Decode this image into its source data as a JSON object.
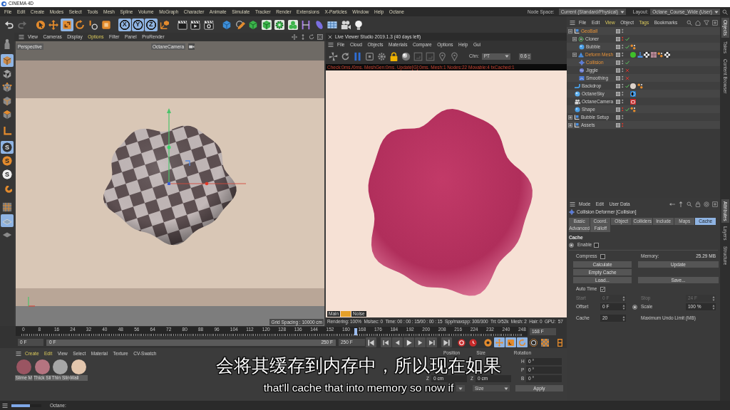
{
  "title_bar": {
    "title": "CINEMA 4D"
  },
  "menu_bar": {
    "items": [
      "File",
      "Edit",
      "Create",
      "Modes",
      "Select",
      "Tools",
      "Mesh",
      "Spline",
      "Volume",
      "MoGraph",
      "Character",
      "Animate",
      "Simulate",
      "Tracker",
      "Render",
      "Extensions",
      "X-Particles",
      "Window",
      "Help",
      "Octane"
    ],
    "node_space": {
      "label": "Node Space:",
      "value": "Current (Standard/Physical)"
    },
    "layout": {
      "label": "Layout:",
      "value": "Octane_Course_Wide (User)"
    }
  },
  "toolbar": [
    {
      "kind": "undo",
      "selected": false
    },
    {
      "kind": "redo",
      "selected": false
    },
    {
      "kind": "select",
      "selected": false
    },
    {
      "kind": "move",
      "selected": false
    },
    {
      "kind": "scale",
      "selected": true
    },
    {
      "kind": "rotate",
      "selected": false
    },
    {
      "kind": "recent",
      "selected": false
    },
    {
      "kind": "tile",
      "selected": false
    },
    {
      "kind": "axis",
      "label": "X",
      "selected": true
    },
    {
      "kind": "axis",
      "label": "Y",
      "selected": true
    },
    {
      "kind": "axis",
      "label": "Z",
      "selected": true
    },
    {
      "kind": "coords",
      "selected": false
    },
    {
      "kind": "renderview",
      "selected": false
    },
    {
      "kind": "render",
      "selected": false
    },
    {
      "kind": "rendersettings",
      "selected": false
    },
    {
      "kind": "cube",
      "selected": false
    },
    {
      "kind": "pen",
      "selected": false
    },
    {
      "kind": "subdivide",
      "selected": false
    },
    {
      "kind": "extrude",
      "selected": false
    },
    {
      "kind": "cloner",
      "selected": false
    },
    {
      "kind": "mograph",
      "selected": false
    },
    {
      "kind": "deformer",
      "selected": false
    },
    {
      "kind": "field",
      "selected": false
    },
    {
      "kind": "floor",
      "selected": false
    },
    {
      "kind": "camera",
      "selected": false
    },
    {
      "kind": "light",
      "selected": false
    }
  ],
  "tool_column": [
    {
      "kind": "figure",
      "selected": false
    },
    {
      "kind": "object",
      "selected": true
    },
    {
      "kind": "texture",
      "selected": false
    },
    {
      "kind": "points",
      "selected": false
    },
    {
      "kind": "edges",
      "selected": false
    },
    {
      "kind": "polygons",
      "selected": false
    },
    {
      "kind": "corner",
      "selected": false
    },
    {
      "kind": "snap",
      "label": "S",
      "selected": true
    },
    {
      "kind": "quantize",
      "label": "S",
      "selected": false
    },
    {
      "kind": "symmetry",
      "label": "S",
      "selected": false
    },
    {
      "kind": "magnet",
      "selected": false
    },
    {
      "kind": "plane",
      "selected": false
    },
    {
      "kind": "workplane",
      "selected": true
    },
    {
      "kind": "grid",
      "selected": false
    }
  ],
  "viewport": {
    "menu": [
      {
        "label": "View",
        "highlighted": false
      },
      {
        "label": "Cameras",
        "highlighted": false
      },
      {
        "label": "Display",
        "highlighted": false
      },
      {
        "label": "Options",
        "highlighted": true
      },
      {
        "label": "Filter",
        "highlighted": false
      },
      {
        "label": "Panel",
        "highlighted": false
      },
      {
        "label": "ProRender",
        "highlighted": false
      }
    ],
    "view_name": "Perspective",
    "camera": "OctaneCamera",
    "grid_spacing": "Grid Spacing : 10000 cm"
  },
  "live_viewer": {
    "title": "Live Viewer Studio 2019.1.3 (40 days left)",
    "menu": [
      "File",
      "Cloud",
      "Objects",
      "Materials",
      "Compare",
      "Options",
      "Help",
      "Gui"
    ],
    "channel": {
      "label": "Chn:",
      "value": "PT"
    },
    "exposure": "0.6",
    "log": "Check:0ms./0ms. MeshGen:0ms. Update[G]:0ms. Mesh:1 Nodes:22 Movable:4 txCached:1",
    "passes": [
      {
        "label": "Main",
        "selected": false
      },
      {
        "selected": true
      },
      {
        "label": "Noise",
        "selected": false
      }
    ],
    "stats": [
      "Rendering: 100%",
      "Ms/sec: 0",
      "Time: 00 : 00 : 15/00 : 00 : 15",
      "Spp/maxspp: 300/300",
      "Tri: 0/52k",
      "Mesh: 2",
      "Hair: 0",
      "GPU:",
      "57"
    ]
  },
  "objects": {
    "menu": [
      {
        "label": "File",
        "highlighted": false
      },
      {
        "label": "Edit",
        "highlighted": false
      },
      {
        "label": "View",
        "highlighted": true
      },
      {
        "label": "Object",
        "highlighted": false
      },
      {
        "label": "Tags",
        "highlighted": true
      },
      {
        "label": "Bookmarks",
        "highlighted": false
      }
    ],
    "items": [
      {
        "name": "GeoBall",
        "kind": "null",
        "selected": true,
        "hidden": false,
        "expanded": true,
        "children": [
          {
            "name": "Cloner",
            "kind": "cloner",
            "selected": false,
            "hidden": true,
            "enabled": true,
            "expanded": true,
            "children": [
              {
                "name": "Bubble",
                "kind": "sphere",
                "selected": false,
                "hidden": false,
                "enabled": true,
                "tags": [
                  {
                    "kind": "dots"
                  }
                ]
              }
            ]
          },
          {
            "name": "Deform Mesh",
            "kind": "deformer",
            "selected": true,
            "hidden": false,
            "expanded": true,
            "tags": [
              {
                "kind": "material",
                "color": "#3fbf2a"
              },
              {
                "kind": "pin"
              },
              {
                "kind": "checker"
              },
              {
                "kind": "texture"
              },
              {
                "kind": "dots"
              },
              {
                "kind": "checker"
              }
            ],
            "children": [
              {
                "name": "Collision",
                "kind": "collision",
                "selected": true,
                "hidden": false,
                "enabled": true
              },
              {
                "name": "Jiggle",
                "kind": "jiggle",
                "selected": false,
                "hidden": false,
                "enabled": false
              },
              {
                "name": "Smoothing",
                "kind": "smoothing",
                "selected": false,
                "hidden": false,
                "enabled": false
              }
            ]
          },
          {
            "name": "Backdrop",
            "kind": "backdrop",
            "selected": false,
            "hidden": false,
            "enabled": true,
            "tags": [
              {
                "kind": "material",
                "color": "#ddd2ca"
              },
              {
                "kind": "dots"
              }
            ]
          },
          {
            "name": "OctaneSky",
            "kind": "sky",
            "selected": false,
            "hidden": false,
            "tags": [
              {
                "kind": "sky"
              }
            ]
          },
          {
            "name": "OctaneCamera",
            "kind": "camera",
            "selected": false,
            "hidden": false,
            "tags": [
              {
                "kind": "camera"
              }
            ]
          },
          {
            "name": "Shape",
            "kind": "sphere",
            "selected": false,
            "hidden": true,
            "enabled": true,
            "tags": [
              {
                "kind": "dots"
              }
            ]
          }
        ]
      },
      {
        "name": "Bubble Setup",
        "kind": "null",
        "selected": false,
        "hidden": false,
        "expanded": false
      },
      {
        "name": "Assets",
        "kind": "null",
        "selected": false,
        "hidden": true,
        "expanded": false
      }
    ]
  },
  "attributes": {
    "menu": [
      "Mode",
      "Edit",
      "User Data"
    ],
    "title": "Collision Deformer [Collision]",
    "tabs": [
      {
        "label": "Basic",
        "selected": false
      },
      {
        "label": "Coord.",
        "selected": false
      },
      {
        "label": "Object",
        "selected": false
      },
      {
        "label": "Colliders",
        "selected": false
      },
      {
        "label": "Include",
        "selected": false
      },
      {
        "label": "Maps",
        "selected": false
      },
      {
        "label": "Cache",
        "selected": true
      },
      {
        "label": "Advanced",
        "selected": false
      },
      {
        "label": "Falloff",
        "selected": false
      }
    ],
    "section": "Cache",
    "enable": {
      "label": "Enable",
      "checked": false,
      "keyable": true
    },
    "compress": {
      "label": "Compress",
      "checked": false
    },
    "memory": {
      "label": "Memory:",
      "value": "25.29 MB"
    },
    "buttons": [
      "Calculate",
      "Update",
      "Empty Cache",
      "Load...",
      "Save..."
    ],
    "auto_time": {
      "label": "Auto Time",
      "checked": true
    },
    "fields": [
      {
        "label": "Start",
        "value": "0 F",
        "disabled": true,
        "keyable": false
      },
      {
        "label": "Stop",
        "value": "24 F",
        "disabled": true,
        "keyable": false
      },
      {
        "label": "Offset",
        "value": "0 F",
        "disabled": false,
        "keyable": false
      },
      {
        "label": "Scale",
        "value": "100 %",
        "disabled": false,
        "keyable": true
      },
      {
        "label": "Cache",
        "value": "20",
        "disabled": false,
        "keyable": false
      }
    ],
    "undo_limit": "Maximum Undo Limit (MB)"
  },
  "side_tabs": {
    "top": [
      {
        "label": "Objects",
        "selected": true
      },
      {
        "label": "Takes",
        "selected": false
      },
      {
        "label": "Content Browser",
        "selected": false
      }
    ],
    "bottom": [
      {
        "label": "Attributes",
        "selected": true
      },
      {
        "label": "Layers",
        "selected": false
      },
      {
        "label": "Structure",
        "selected": false
      }
    ]
  },
  "timeline": {
    "frames": [
      "0",
      "8",
      "16",
      "24",
      "32",
      "40",
      "48",
      "56",
      "64",
      "72",
      "80",
      "88",
      "96",
      "104",
      "112",
      "120",
      "128",
      "136",
      "144",
      "152",
      "160",
      "168",
      "176",
      "184",
      "192",
      "200",
      "208",
      "216",
      "224",
      "232",
      "240",
      "248"
    ],
    "playhead": {
      "level": 0.672
    },
    "current": "168 F"
  },
  "transport": {
    "start": "0 F",
    "range": {
      "start": "0 F",
      "end": "250 F",
      "level": 1
    },
    "end": "250 F",
    "buttons": [
      {
        "kind": "first",
        "selected": false
      },
      {
        "kind": "prevkey",
        "selected": false
      },
      {
        "kind": "prev",
        "selected": false
      },
      {
        "kind": "play",
        "selected": false
      },
      {
        "kind": "next",
        "selected": false
      },
      {
        "kind": "nextkey",
        "selected": false
      },
      {
        "kind": "last",
        "selected": false
      },
      {
        "kind": "record",
        "selected": false
      },
      {
        "kind": "autokey",
        "selected": false
      },
      {
        "kind": "keytarget",
        "selected": false
      },
      {
        "kind": "keymove",
        "selected": true
      },
      {
        "kind": "keyscale",
        "selected": true
      },
      {
        "kind": "keyrotate",
        "selected": true
      },
      {
        "kind": "keyparam",
        "selected": false
      },
      {
        "kind": "keypla",
        "selected": false
      },
      {
        "kind": "timeline",
        "selected": false
      }
    ]
  },
  "materials": {
    "menu": [
      {
        "label": "Create",
        "highlighted": true
      },
      {
        "label": "Edit",
        "highlighted": true
      },
      {
        "label": "View",
        "highlighted": false
      },
      {
        "label": "Select",
        "highlighted": false
      },
      {
        "label": "Material",
        "highlighted": false
      },
      {
        "label": "Texture",
        "highlighted": false
      },
      {
        "label": "CV-Swatch",
        "highlighted": false
      }
    ],
    "items": [
      {
        "name": "Slime M",
        "color": "#9a5562"
      },
      {
        "name": "Thick Sli",
        "color": "#b57480"
      },
      {
        "name": "Thin Slin",
        "color": "#a6a6a6"
      },
      {
        "name": "Wall",
        "color": "#e3c6ad"
      }
    ]
  },
  "coordinates": {
    "headers": [
      "Position",
      "Size",
      "Rotation"
    ],
    "position_z": {
      "axis": "Z",
      "value": "0 cm"
    },
    "size_z": {
      "axis": "Z",
      "value": "0 cm"
    },
    "rotation": [
      {
        "axis": "H",
        "value": "0 °"
      },
      {
        "axis": "P",
        "value": "0 °"
      },
      {
        "axis": "B",
        "value": "0 °"
      }
    ],
    "mode": "Size",
    "apply": "Apply"
  },
  "status_bar": {
    "progress": {
      "level": 0.62
    },
    "label": "Octane:"
  },
  "subtitles": [
    "会将其缓存到内存中，所以现在如果",
    "that'll cache that into memory so now if"
  ]
}
